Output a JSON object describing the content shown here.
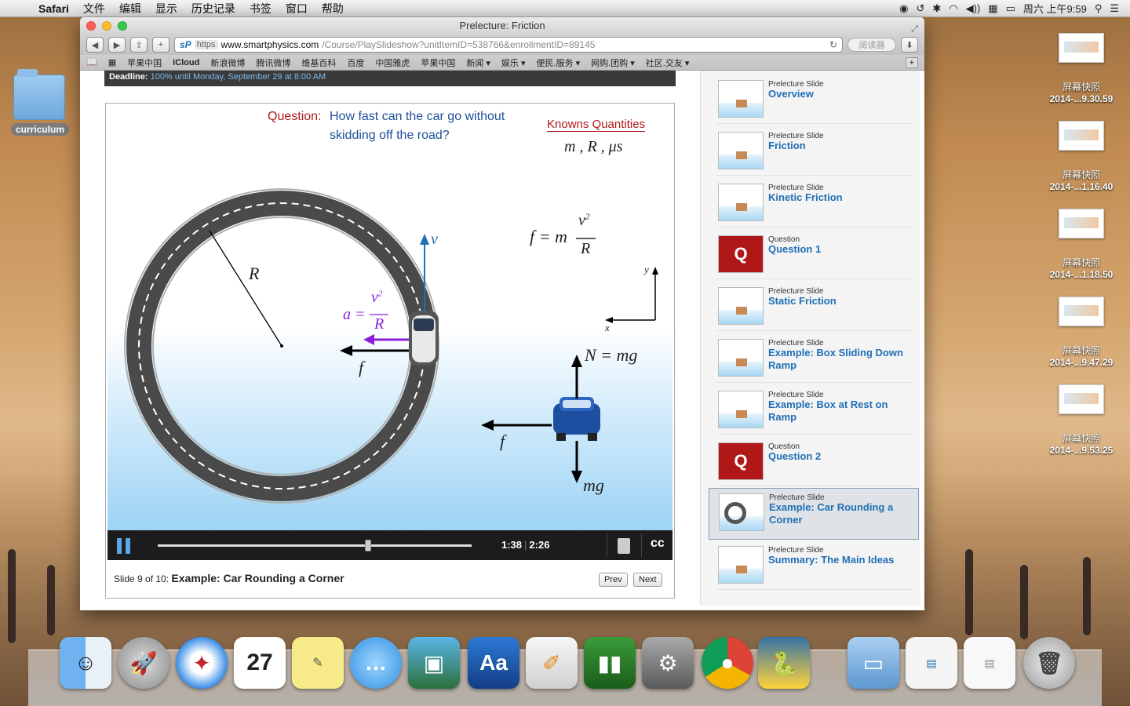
{
  "menubar": {
    "app": "Safari",
    "items": [
      "文件",
      "编辑",
      "显示",
      "历史记录",
      "书签",
      "窗口",
      "帮助"
    ],
    "clock": "周六 上午9:59"
  },
  "desktop": {
    "folder_label": "curriculum",
    "screenshots": [
      {
        "line1": "屏幕快照",
        "line2": "2014-...9.30.59"
      },
      {
        "line1": "屏幕快照",
        "line2": "2014-...1.16.40"
      },
      {
        "line1": "屏幕快照",
        "line2": "2014-...1.18.50"
      },
      {
        "line1": "屏幕快照",
        "line2": "2014-...9.47.29"
      },
      {
        "line1": "屏幕快照",
        "line2": "2014-...9.53.25"
      }
    ]
  },
  "browser": {
    "title": "Prelecture: Friction",
    "address": {
      "scheme": "https",
      "host": "www.smartphysics.com",
      "path": "/Course/PlaySlideshow?unitItemID=538766&enrollmentID=89145"
    },
    "reader_label": "阅读器",
    "bookmarks": [
      "苹果中国",
      "iCloud",
      "新浪微博",
      "腾讯微博",
      "维基百科",
      "百度",
      "中国雅虎",
      "苹果中国",
      "新闻 ▾",
      "娱乐 ▾",
      "便民.服务 ▾",
      "网购.团购 ▾",
      "社区.交友 ▾"
    ]
  },
  "deadline": {
    "label": "Deadline:",
    "value": "100% until Monday, September 29 at 8:00 AM"
  },
  "slide": {
    "question_label": "Question:",
    "question_line1": "How fast can the car go without",
    "question_line2": "skidding off the road?",
    "knowns_title": "Knowns Quantities",
    "knowns_vars": "m , R , μs",
    "labels": {
      "R": "R",
      "v": "v",
      "a": "a =",
      "f1": "f",
      "f2": "f",
      "N": "N = mg",
      "mg": "mg",
      "x": "x",
      "y": "y"
    },
    "formula_main": "f = m v²/R",
    "formula_a": "v²/R"
  },
  "player": {
    "current_time": "1:38",
    "total_time": "2:26",
    "progress": 0.67,
    "slide_counter": "Slide 9 of 10:",
    "slide_title": "Example: Car Rounding a Corner",
    "prev_label": "Prev",
    "next_label": "Next"
  },
  "sidebar": {
    "items": [
      {
        "type": "Prelecture Slide",
        "title": "Overview",
        "kind": "slide"
      },
      {
        "type": "Prelecture Slide",
        "title": "Friction",
        "kind": "slide"
      },
      {
        "type": "Prelecture Slide",
        "title": "Kinetic Friction",
        "kind": "slide"
      },
      {
        "type": "Question",
        "title": "Question 1",
        "kind": "question"
      },
      {
        "type": "Prelecture Slide",
        "title": "Static Friction",
        "kind": "slide"
      },
      {
        "type": "Prelecture Slide",
        "title": "Example: Box Sliding Down Ramp",
        "kind": "slide"
      },
      {
        "type": "Prelecture Slide",
        "title": "Example: Box at Rest on Ramp",
        "kind": "slide"
      },
      {
        "type": "Question",
        "title": "Question 2",
        "kind": "question"
      },
      {
        "type": "Prelecture Slide",
        "title": "Example: Car Rounding a Corner",
        "kind": "active"
      },
      {
        "type": "Prelecture Slide",
        "title": "Summary: The Main Ideas",
        "kind": "slide"
      }
    ]
  },
  "colors": {
    "accent_blue": "#1f6fb5",
    "question_red": "#b01818",
    "vector_purple": "#8a1fd8",
    "vector_blue": "#1f6fb5"
  }
}
